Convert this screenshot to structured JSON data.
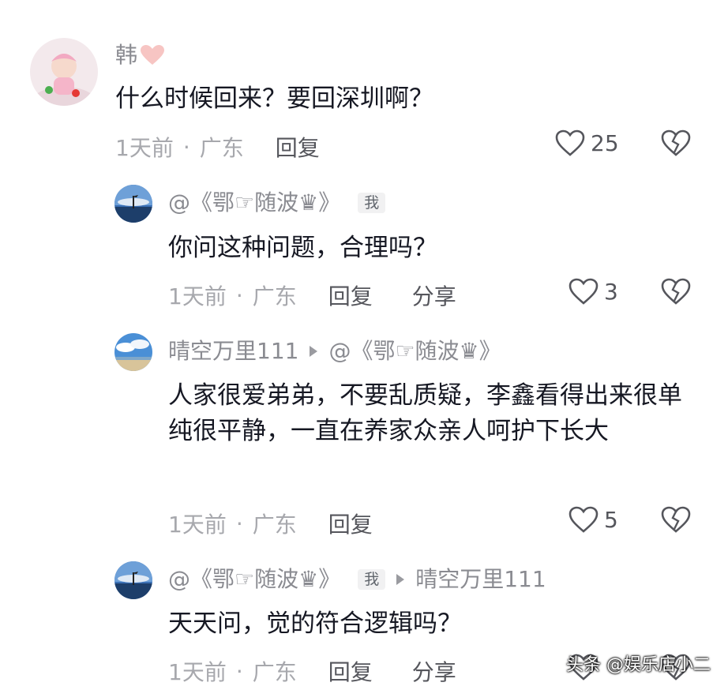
{
  "comments": [
    {
      "username": "韩",
      "text": "什么时候回来？要回深圳啊？",
      "time": "1天前",
      "location": "广东",
      "reply_label": "回复",
      "likes": "25"
    },
    {
      "username": "@《鄂☞随波♛》",
      "badge": "我",
      "text": "你问这种问题，合理吗？",
      "time": "1天前",
      "location": "广东",
      "reply_label": "回复",
      "share_label": "分享",
      "likes": "3"
    },
    {
      "username": "晴空万里111",
      "reply_to": "@《鄂☞随波♛》",
      "text": "人家很爱弟弟，不要乱质疑，李鑫看得出来很单纯很平静，一直在养家众亲人呵护下长大",
      "time": "1天前",
      "location": "广东",
      "reply_label": "回复",
      "likes": "5"
    },
    {
      "username": "@《鄂☞随波♛》",
      "badge": "我",
      "reply_to": "晴空万里111",
      "text": "天天问，觉的符合逻辑吗？",
      "time": "1天前",
      "location": "广东",
      "reply_label": "回复",
      "share_label": "分享"
    }
  ],
  "separator": "·",
  "watermark": "头条 @娱乐店小二",
  "icons": [
    "heart-outline-icon",
    "broken-heart-icon",
    "pink-heart-icon",
    "reply-arrow-icon"
  ],
  "colors": {
    "text": "#161823",
    "muted": "#a7a8ad",
    "username": "#8a8b91",
    "heart_pink": "#f7c5c3"
  }
}
